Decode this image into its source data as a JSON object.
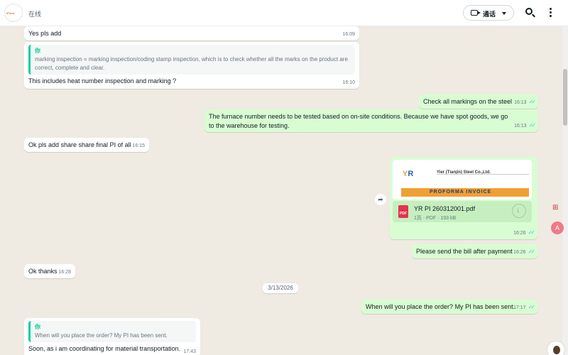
{
  "header": {
    "status": "在线",
    "avatar_text": "iPoint",
    "call_label": "通话"
  },
  "date_divider": "3/13/2026",
  "messages": {
    "m1": {
      "text": "Yes pls add",
      "time": "16:09"
    },
    "m2": {
      "quote_author": "你",
      "quote_text": "marking inspection = marking inspection/coding stamp inspection, which is to check whether all the marks on the product are correct, complete and clear.",
      "text": "This includes heat number inspection and marking ?",
      "time": "16:10"
    },
    "m3": {
      "text": "Check all markings on the steel",
      "time": "16:13"
    },
    "m4": {
      "text": "The furnace number needs to be tested based on on-site conditions. Because we have spot goods, we go to the warehouse for testing.",
      "time": "16:13"
    },
    "m5": {
      "text": "Ok pls add share share final PI of all",
      "time": "16:15"
    },
    "doc": {
      "preview_company": "Yier (Tianjin) Steel Co.,Ltd.",
      "preview_band": "PROFORMA     INVOICE",
      "pdf_label": "PDF",
      "file_name": "YR PI 260312001.pdf",
      "meta": "1页 · PDF · 193 kB",
      "time": "16:26"
    },
    "m6": {
      "text": "Please send the bill after payment",
      "time": "16:26"
    },
    "m7": {
      "text": "Ok thanks",
      "time": "16:28"
    },
    "m8": {
      "text": "When will you place the order? My PI has been sent.",
      "time": "17:17"
    },
    "m9": {
      "quote_author": "你",
      "quote_text": "When will you place the order? My PI has been sent.",
      "text": "Soon, as i am coordinating for material transportation.",
      "time": "17:43"
    }
  },
  "icons": [
    "video-icon",
    "search-icon",
    "menu-icon",
    "forward-icon",
    "pdf-icon",
    "download-icon",
    "read-ticks-icon",
    "side-apps-icon",
    "side-translate-icon"
  ],
  "colors": {
    "outgoing_bubble": "#d9fdd3",
    "incoming_bubble": "#ffffff",
    "chat_background": "#efeae2",
    "read_ticks": "#53bdeb",
    "quote_accent": "#06cf9c"
  }
}
